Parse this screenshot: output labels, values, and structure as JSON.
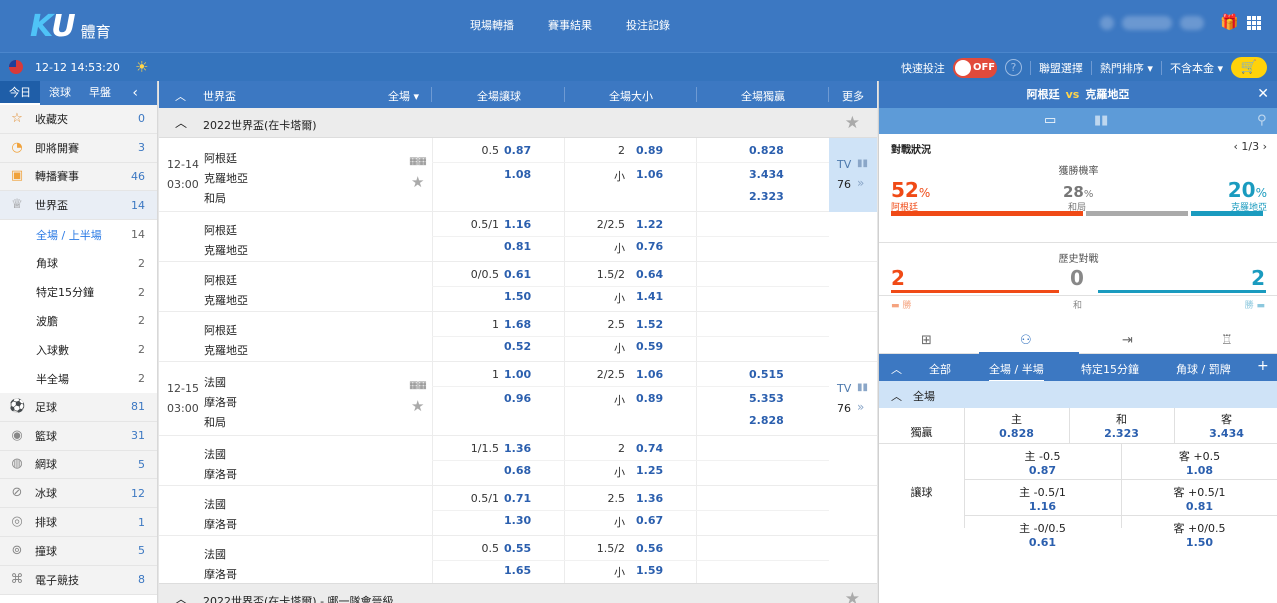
{
  "header": {
    "logo_text": "KU",
    "logo_sub": "體育",
    "nav": [
      "現場轉播",
      "賽事結果",
      "投注記錄"
    ]
  },
  "subbar": {
    "datetime": "12-12 14:53:20",
    "quick_bet": "快速投注",
    "toggle": "OFF",
    "help": "?",
    "league_select": "聯盟選擇",
    "sort": "熱門排序 ▾",
    "currency": "不含本金 ▾"
  },
  "sidebar": {
    "tabs": [
      "今日",
      "滾球",
      "早盤"
    ],
    "items": [
      {
        "label": "收藏夾",
        "count": "0",
        "icon": "☆"
      },
      {
        "label": "即將開賽",
        "count": "3",
        "icon": "◔"
      },
      {
        "label": "轉播賽事",
        "count": "46",
        "icon": "▣"
      },
      {
        "label": "世界盃",
        "count": "14",
        "icon": "♕"
      },
      {
        "label": "全場 / 上半場",
        "count": "14",
        "sub": true
      },
      {
        "label": "角球",
        "count": "2",
        "sub": true
      },
      {
        "label": "特定15分鐘",
        "count": "2",
        "sub": true
      },
      {
        "label": "波膽",
        "count": "2",
        "sub": true
      },
      {
        "label": "入球數",
        "count": "2",
        "sub": true
      },
      {
        "label": "半全場",
        "count": "2",
        "sub": true
      },
      {
        "label": "足球",
        "count": "81",
        "icon": "⚽"
      },
      {
        "label": "籃球",
        "count": "31",
        "icon": "◉"
      },
      {
        "label": "網球",
        "count": "5",
        "icon": "◍"
      },
      {
        "label": "冰球",
        "count": "12",
        "icon": "⊘"
      },
      {
        "label": "排球",
        "count": "1",
        "icon": "◎"
      },
      {
        "label": "撞球",
        "count": "5",
        "icon": "⊚"
      },
      {
        "label": "電子競技",
        "count": "8",
        "icon": "⌘"
      }
    ]
  },
  "main": {
    "header": {
      "league": "世界盃",
      "period": "全場",
      "handicap": "全場讓球",
      "overunder": "全場大小",
      "moneyline": "全場獨贏",
      "more": "更多"
    },
    "league_title": "2022世界盃(在卡塔爾)",
    "league_title2": "2022世界盃(在卡塔爾) - 哪一隊會晉級",
    "match1": {
      "date": "12-14",
      "time": "03:00",
      "home": "阿根廷",
      "away": "克羅地亞",
      "draw": "和局",
      "more": "76",
      "rows": [
        {
          "hdp": "0.5",
          "hh": "0.87",
          "ha": "1.08",
          "ou": "2",
          "oo": "0.89",
          "ou2": "小",
          "uo": "1.06",
          "m1": "0.828",
          "m2": "3.434",
          "m3": "2.323"
        },
        {
          "hdp": "0.5/1",
          "hh": "1.16",
          "ha": "0.81",
          "ou": "2/2.5",
          "oo": "1.22",
          "ou2": "小",
          "uo": "0.76"
        },
        {
          "hdp": "0/0.5",
          "hh": "0.61",
          "ha": "1.50",
          "ou": "1.5/2",
          "oo": "0.64",
          "ou2": "小",
          "uo": "1.41"
        },
        {
          "hdp": "1",
          "hh": "1.68",
          "ha": "0.52",
          "ou": "2.5",
          "oo": "1.52",
          "ou2": "小",
          "uo": "0.59"
        }
      ]
    },
    "match2": {
      "date": "12-15",
      "time": "03:00",
      "home": "法國",
      "away": "摩洛哥",
      "draw": "和局",
      "more": "76",
      "rows": [
        {
          "hdp": "1",
          "hh": "1.00",
          "ha": "0.96",
          "ou": "2/2.5",
          "oo": "1.06",
          "ou2": "小",
          "uo": "0.89",
          "m1": "0.515",
          "m2": "5.353",
          "m3": "2.828"
        },
        {
          "hdp": "1/1.5",
          "hh": "1.36",
          "ha": "0.68",
          "ou": "2",
          "oo": "0.74",
          "ou2": "小",
          "uo": "1.25"
        },
        {
          "hdp": "0.5/1",
          "hh": "0.71",
          "ha": "1.30",
          "ou": "2.5",
          "oo": "1.36",
          "ou2": "小",
          "uo": "0.67"
        },
        {
          "hdp": "0.5",
          "hh": "0.55",
          "ha": "1.65",
          "ou": "1.5/2",
          "oo": "0.56",
          "ou2": "小",
          "uo": "1.59"
        }
      ]
    },
    "tv": "TV"
  },
  "right": {
    "home": "阿根廷",
    "vs": "vs",
    "away": "克羅地亞",
    "stats_title": "對戰狀況",
    "pager": "‹ 1/3 ›",
    "win_prob": "獲勝機率",
    "home_pct": "52",
    "draw_pct": "28",
    "away_pct": "20",
    "pct": "%",
    "home_name": "阿根廷",
    "draw_name": "和局",
    "away_name": "克羅地亞",
    "history": "歷史對戰",
    "h_home": "2",
    "h_draw": "0",
    "h_away": "2",
    "h_draw_lbl": "和",
    "h_home_lbl": "勝",
    "h_away_lbl": "勝",
    "market_tabs": [
      "全部",
      "全場 / 半場",
      "特定15分鐘",
      "角球 / 罰牌"
    ],
    "section": "全場",
    "moneyline": {
      "label": "獨贏",
      "c1": "主",
      "v1": "0.828",
      "c2": "和",
      "v2": "2.323",
      "c3": "客",
      "v3": "3.434"
    },
    "handicap": {
      "label": "讓球",
      "rows": [
        {
          "l": "主 -0.5",
          "lv": "0.87",
          "r": "客 +0.5",
          "rv": "1.08"
        },
        {
          "l": "主 -0.5/1",
          "lv": "1.16",
          "r": "客 +0.5/1",
          "rv": "0.81"
        },
        {
          "l": "主 -0/0.5",
          "lv": "0.61",
          "r": "客 +0/0.5",
          "rv": "1.50"
        }
      ]
    }
  }
}
